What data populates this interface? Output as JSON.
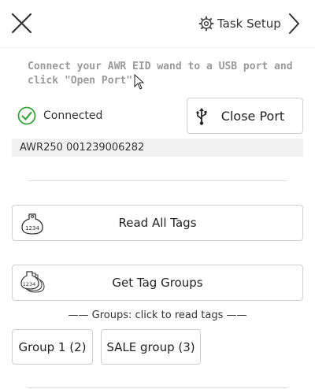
{
  "header": {
    "close_icon": "close-icon",
    "settings_icon": "gear-icon",
    "task_setup_label": "Task Setup",
    "next_icon": "chevron-right-icon"
  },
  "instructions": "Connect your AWR EID wand to a USB port and click \"Open Port\"",
  "connection": {
    "status_icon": "check-circle-icon",
    "status_label": "Connected",
    "status_color": "#3aa23a",
    "port_button_icon": "usb-icon",
    "port_button_label": "Close Port",
    "device_info": "AWR250 001239006282"
  },
  "actions": {
    "read_all_label": "Read All Tags",
    "read_all_icon": "ear-tag-icon",
    "get_groups_label": "Get Tag Groups",
    "get_groups_icon": "ear-tags-stack-icon"
  },
  "groups": {
    "header": "—— Groups: click to read tags ——",
    "items": [
      {
        "label": "Group 1 (2)"
      },
      {
        "label": "SALE group (3)"
      }
    ]
  }
}
